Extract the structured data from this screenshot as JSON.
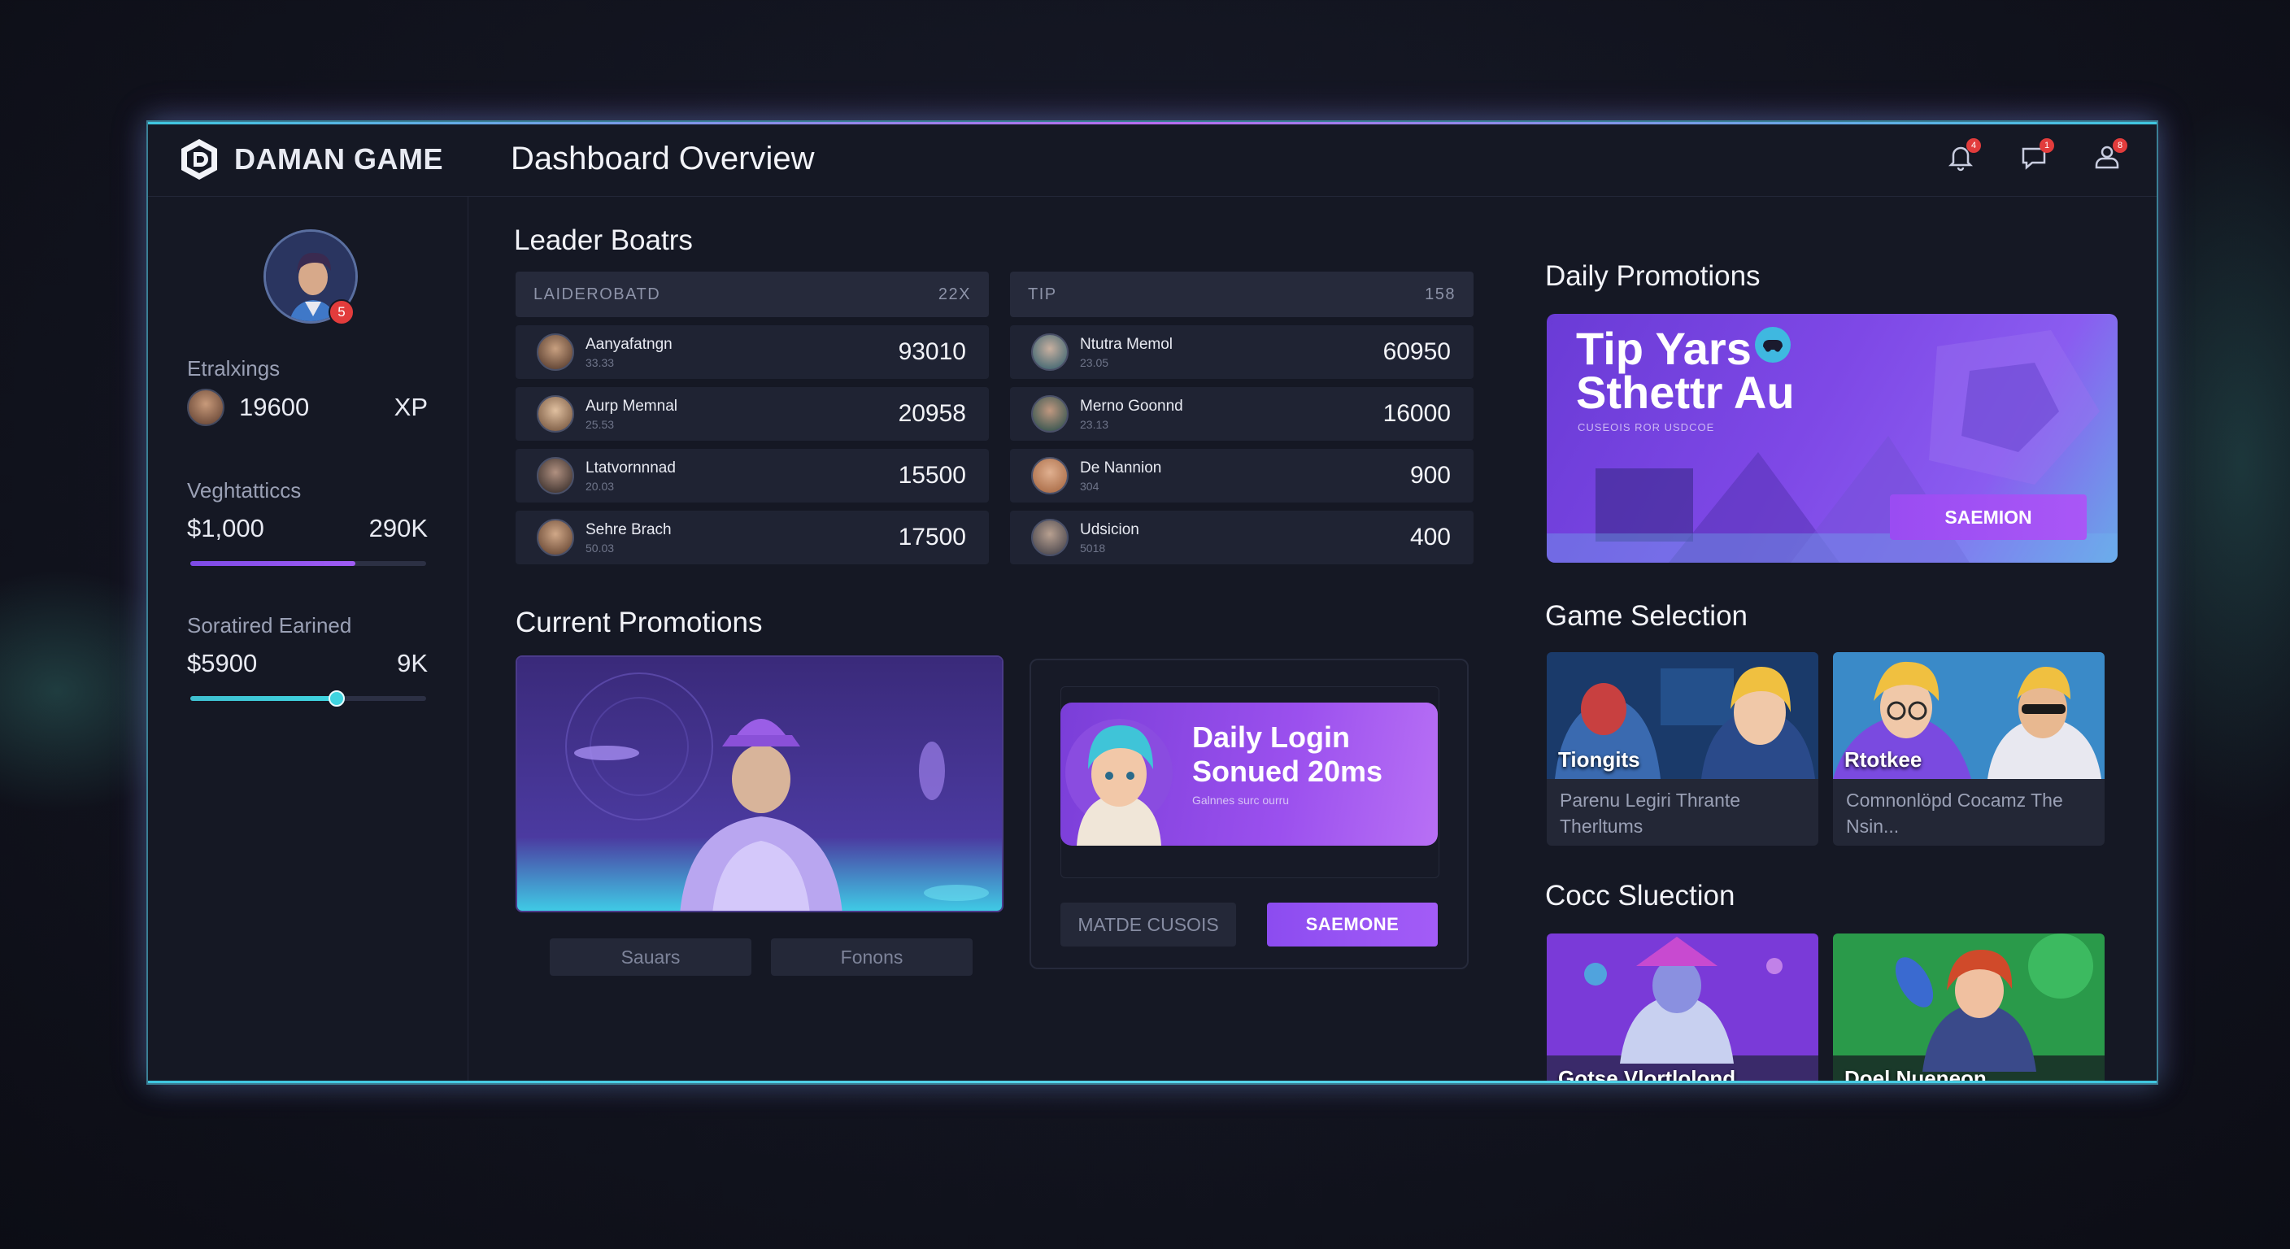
{
  "app": {
    "name": "DAMAN GAME"
  },
  "header": {
    "title": "Dashboard Overview"
  },
  "top_icons": [
    {
      "name": "notification-bell-icon",
      "badge": "4"
    },
    {
      "name": "chat-icon",
      "badge": "1"
    },
    {
      "name": "user-icon",
      "badge": "8"
    }
  ],
  "sidebar": {
    "avatar_badge": "5",
    "rankings": {
      "label": "Etralxings",
      "value": "19600",
      "unit": "XP"
    },
    "vechtattices": {
      "label": "Veghtatticcs",
      "value": "$1,000",
      "max": "290K",
      "progress": 0.7
    },
    "earned": {
      "label": "Soratired Earined",
      "value": "$5900",
      "max": "9K",
      "progress": 0.62
    }
  },
  "leaderboards": {
    "title": "Leader Boatrs",
    "left": {
      "header": "LAIDEROBATD",
      "header_count": "22X",
      "rows": [
        {
          "name": "Aanyafatngn",
          "sub": "33.33",
          "score": "93010"
        },
        {
          "name": "Aurp Memnal",
          "sub": "25.53",
          "score": "20958"
        },
        {
          "name": "Ltatvornnnad",
          "sub": "20.03",
          "score": "15500"
        },
        {
          "name": "Sehre Brach",
          "sub": "50.03",
          "score": "17500"
        }
      ]
    },
    "right": {
      "header": "TIP",
      "header_count": "158",
      "rows": [
        {
          "name": "Ntutra Memol",
          "sub": "23.05",
          "score": "60950"
        },
        {
          "name": "Merno Goonnd",
          "sub": "23.13",
          "score": "16000"
        },
        {
          "name": "De Nannion",
          "sub": "304",
          "score": "900"
        },
        {
          "name": "Udsicion",
          "sub": "5018",
          "score": "400"
        }
      ]
    }
  },
  "current_promotions": {
    "title": "Current Promotions",
    "tabs": [
      "Sauars",
      "Fonons"
    ],
    "login_banner": {
      "title": "Daily Login Sonued 20ms",
      "subtitle": "Galnnes surc ourru"
    },
    "buttons": {
      "secondary": "MATDE CUSOIS",
      "primary": "SAEMONE"
    }
  },
  "daily_promotions": {
    "title": "Daily Promotions",
    "banner_title_line1": "Tip Yars",
    "banner_title_line2": "Sthettr Au",
    "banner_sub": "CUSEOIS ROR USDCOE",
    "button": "SAEMION"
  },
  "game_selection": {
    "title": "Game Selection",
    "games": [
      {
        "name": "Tiongits",
        "desc": "Parenu Legiri Thrante Therltums"
      },
      {
        "name": "Rtotkee",
        "desc": "Comnonlöpd Cocamz The Nsin..."
      }
    ]
  },
  "cocc_selection": {
    "title": "Cocc Sluection",
    "items": [
      {
        "name": "Gotse Vlortlolond"
      },
      {
        "name": "Doel Nueneon"
      }
    ]
  },
  "colors": {
    "accent_purple": "#9a4cf2",
    "accent_cyan": "#3fd4e0",
    "badge_red": "#e23c3c"
  }
}
